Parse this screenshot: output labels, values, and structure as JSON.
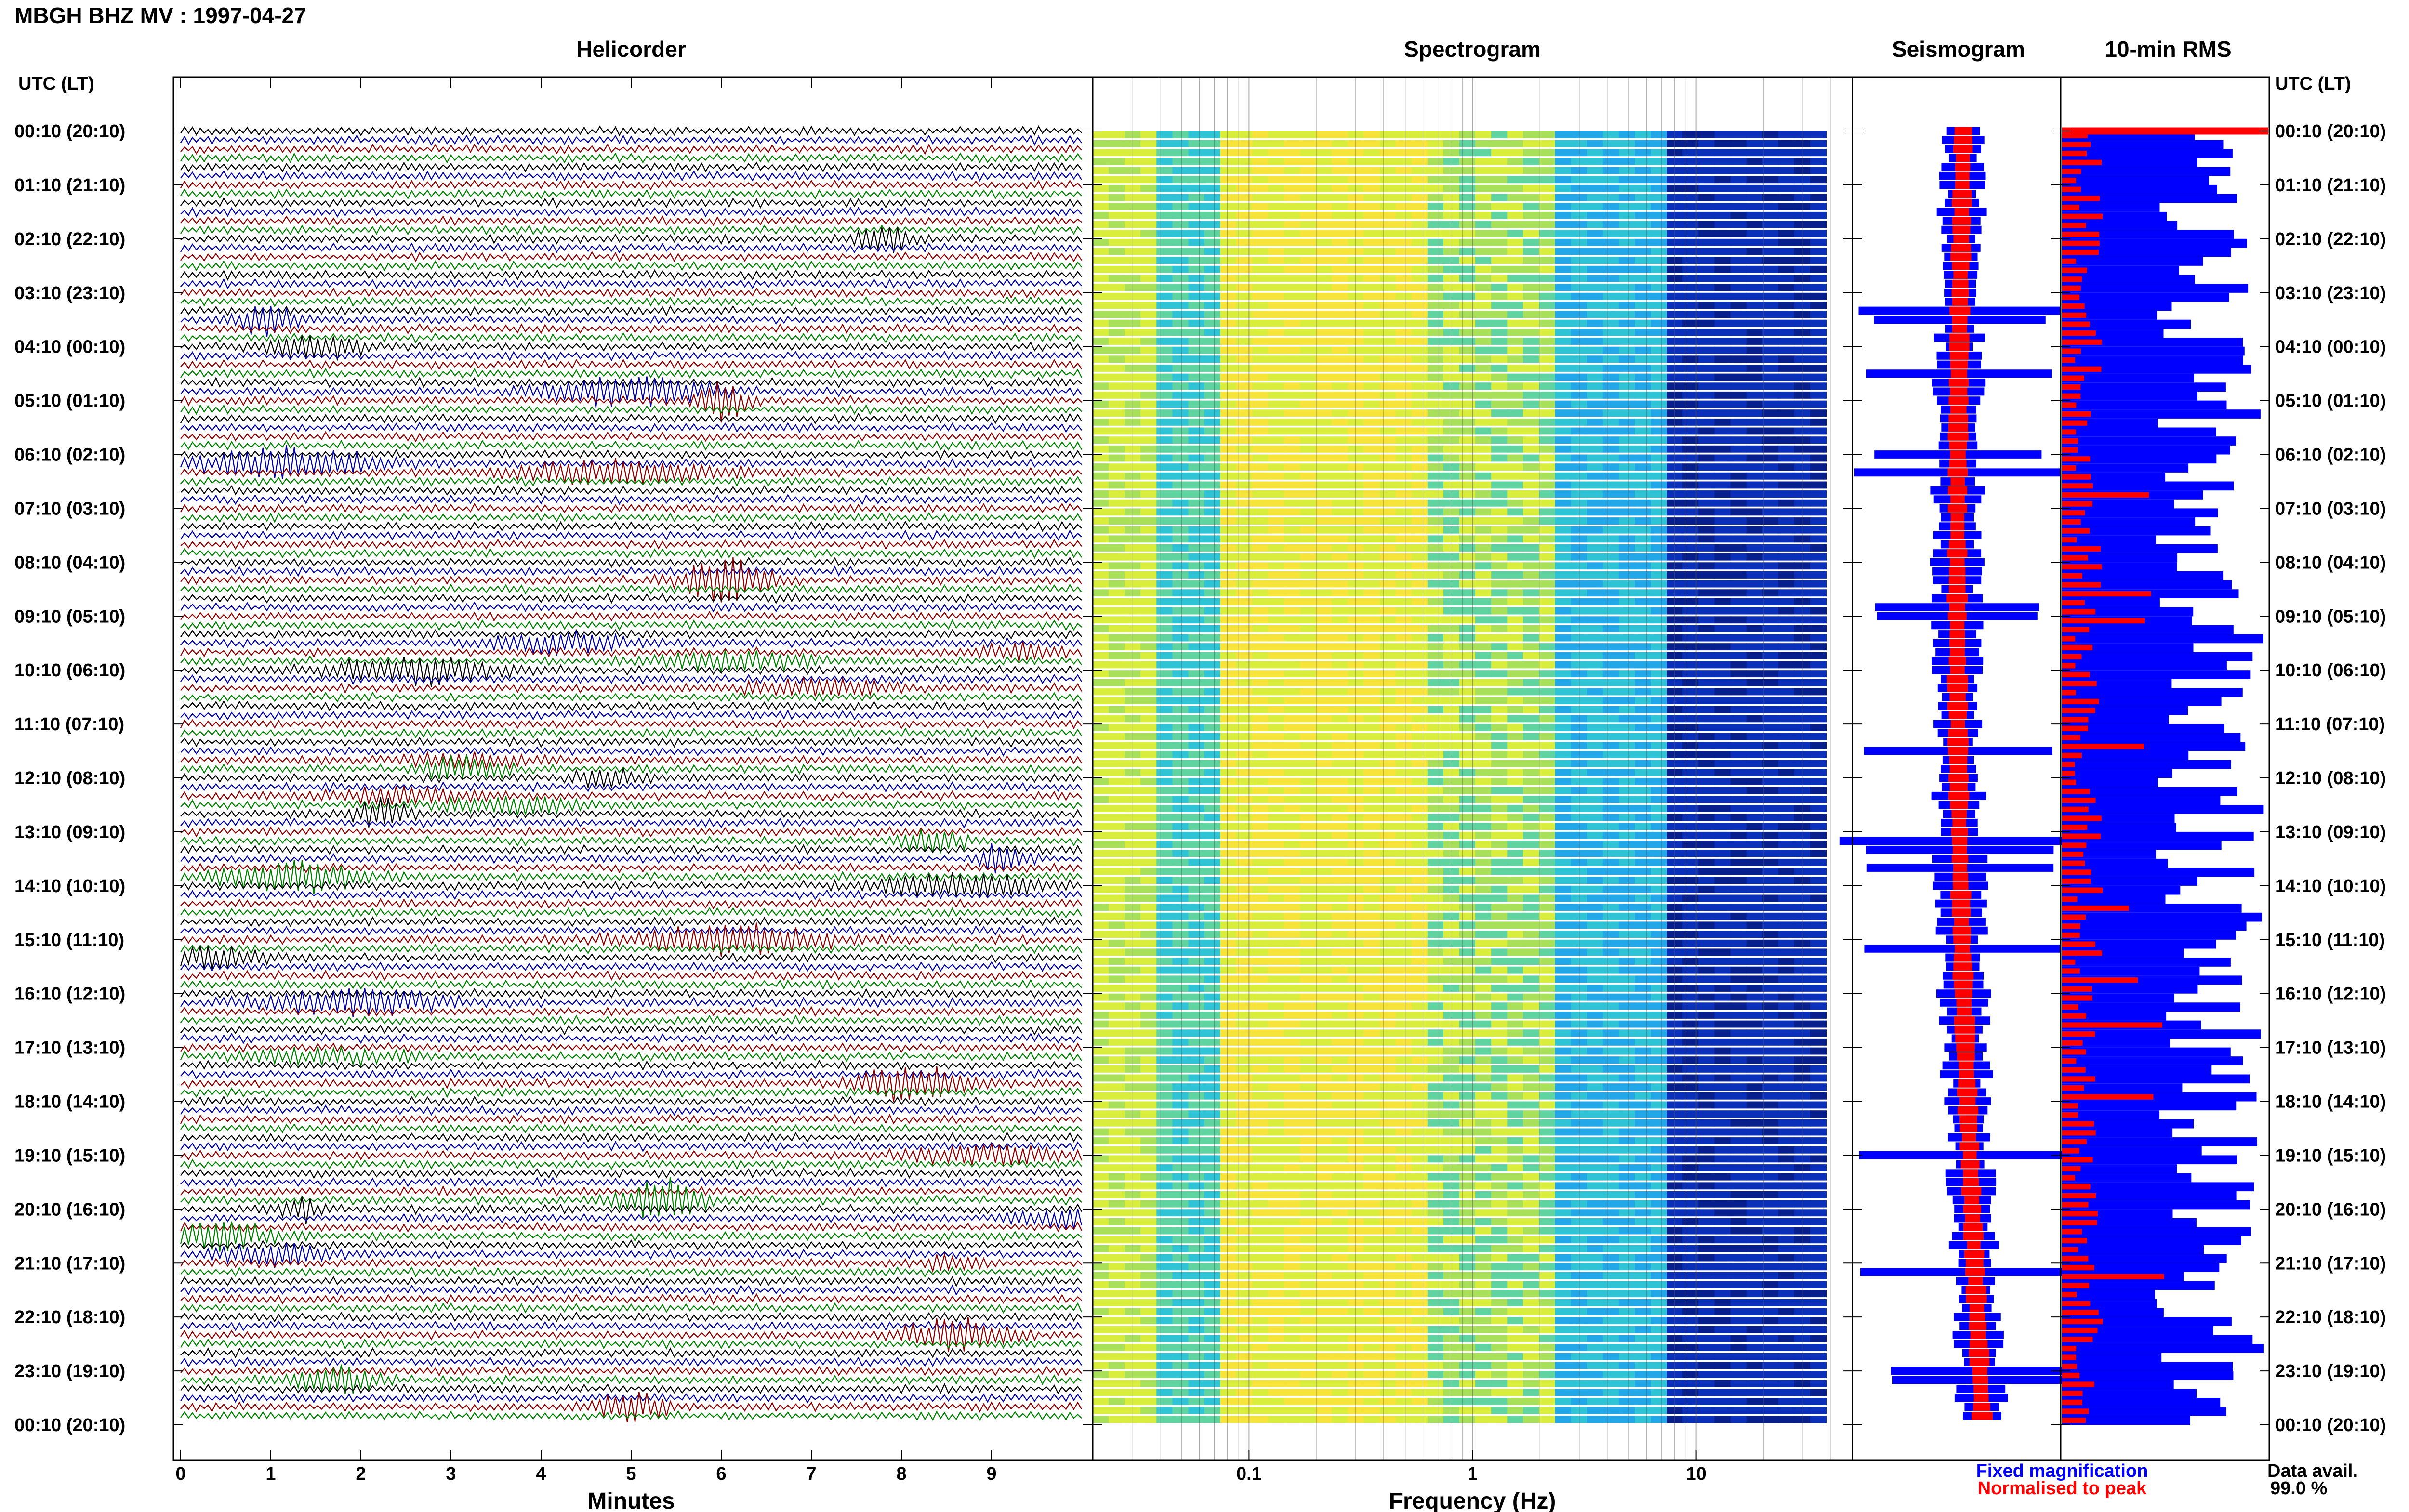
{
  "title": "MBGH BHZ MV : 1997-04-27",
  "panels": {
    "helicorder": "Helicorder",
    "spectrogram": "Spectrogram",
    "seismogram": "Seismogram",
    "rms": "10-min RMS"
  },
  "time_axis_label_left": "UTC (LT)",
  "time_axis_label_right": "UTC (LT)",
  "time_ticks": [
    "00:10 (20:10)",
    "01:10 (21:10)",
    "02:10 (22:10)",
    "03:10 (23:10)",
    "04:10 (00:10)",
    "05:10 (01:10)",
    "06:10 (02:10)",
    "07:10 (03:10)",
    "08:10 (04:10)",
    "09:10 (05:10)",
    "10:10 (06:10)",
    "11:10 (07:10)",
    "12:10 (08:10)",
    "13:10 (09:10)",
    "14:10 (10:10)",
    "15:10 (11:10)",
    "16:10 (12:10)",
    "17:10 (13:10)",
    "18:10 (14:10)",
    "19:10 (15:10)",
    "20:10 (16:10)",
    "21:10 (17:10)",
    "22:10 (18:10)",
    "23:10 (19:10)",
    "00:10 (20:10)"
  ],
  "legend": {
    "fixed": "Fixed magnification",
    "normalised": "Normalised to peak",
    "fixed_color": "#0000ff",
    "normalised_color": "#ff0000"
  },
  "data_avail": {
    "label": "Data avail.",
    "value": "99.0 %"
  },
  "colors": {
    "trace_cycle": [
      "#000000",
      "#0000a0",
      "#8b0000",
      "#008000"
    ],
    "spectrogram_low": "#c8e63c",
    "spectrogram_mid": "#2ec4d6",
    "spectrogram_high": "#0033cc",
    "rms_fixed": "#0000ff",
    "rms_norm": "#ff0000"
  },
  "chart_data": [
    {
      "type": "line",
      "name": "helicorder",
      "xlabel": "Minutes",
      "xlim": [
        0,
        10
      ],
      "xticks": [
        0,
        1,
        2,
        3,
        4,
        5,
        6,
        7,
        8,
        9
      ],
      "rows": 144,
      "row_minutes": 10
    },
    {
      "type": "heatmap",
      "name": "spectrogram",
      "xlabel": "Frequency (Hz)",
      "xscale": "log",
      "xlim": [
        0.02,
        50
      ],
      "xticks": [
        0.1,
        1,
        10
      ],
      "xticklabels": [
        "0.1",
        "1",
        "10"
      ],
      "rows": 144
    },
    {
      "type": "line",
      "name": "seismogram",
      "series": [
        {
          "name": "Fixed magnification"
        },
        {
          "name": "Normalised to peak"
        }
      ]
    },
    {
      "type": "bar",
      "name": "rms",
      "orientation": "horizontal",
      "rows": 144,
      "series": [
        {
          "name": "Fixed magnification"
        },
        {
          "name": "Normalised to peak"
        }
      ]
    }
  ]
}
